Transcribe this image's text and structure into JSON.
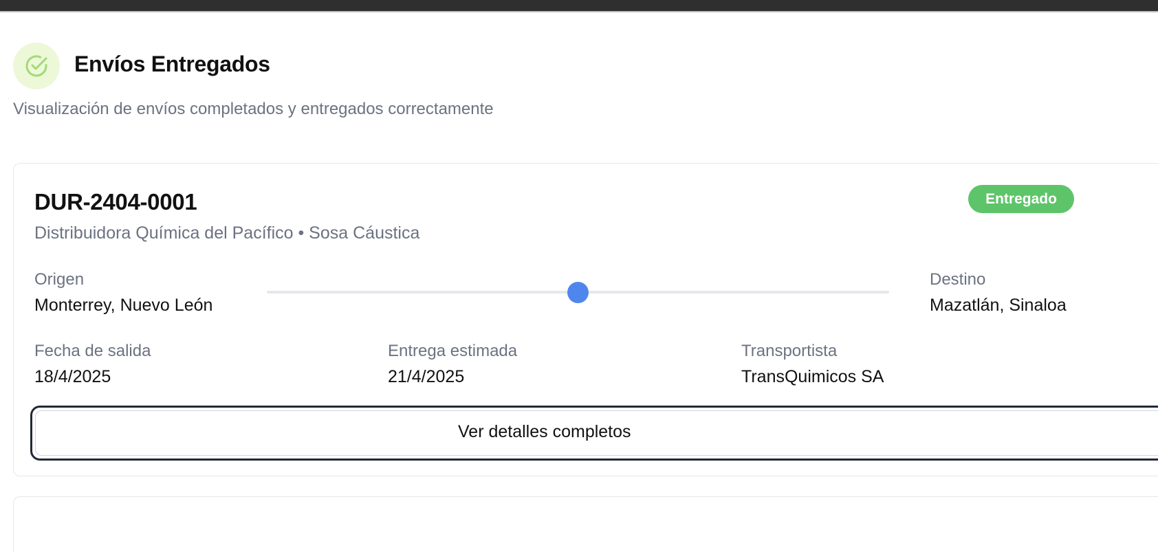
{
  "header": {
    "icon": "check-circle-icon",
    "title": "Envíos Entregados",
    "subtitle": "Visualización de envíos completados y entregados correctamente"
  },
  "shipment": {
    "id": "DUR-2404-0001",
    "meta": "Distribuidora Química del Pacífico • Sosa Cáustica",
    "status": "Entregado",
    "status_color": "#5ec46a",
    "origin_label": "Origen",
    "origin_value": "Monterrey, Nuevo León",
    "destination_label": "Destino",
    "destination_value": "Mazatlán, Sinaloa",
    "route_progress": 0.5,
    "departure_label": "Fecha de salida",
    "departure_value": "18/4/2025",
    "estimated_label": "Entrega estimada",
    "estimated_value": "21/4/2025",
    "carrier_label": "Transportista",
    "carrier_value": "TransQuimicos SA",
    "details_button": "Ver detalles completos"
  },
  "colors": {
    "accent": "#4f86ee",
    "success": "#5ec46a",
    "icon_bg": "#ecf8d8"
  }
}
